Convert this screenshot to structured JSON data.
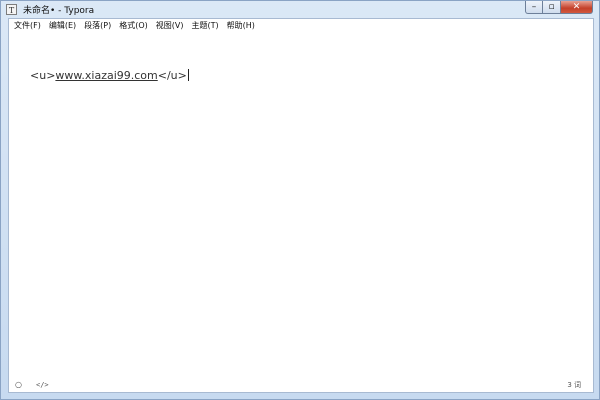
{
  "window": {
    "title": "未命名• - Typora",
    "app_icon_glyph": "T",
    "minimize_glyph": "–",
    "maximize_glyph": "▫",
    "close_glyph": "✕"
  },
  "menu": {
    "items": [
      "文件(F)",
      "编辑(E)",
      "段落(P)",
      "格式(O)",
      "视图(V)",
      "主题(T)",
      "帮助(H)"
    ]
  },
  "editor": {
    "open_tag": "<u>",
    "link_text": "www.xiazai99.com",
    "close_tag": "</u>"
  },
  "status": {
    "outline_icon_glyph": "○",
    "source_icon_glyph": "</>",
    "word_count": "3 词"
  },
  "icons": {
    "app": "typora-app-icon",
    "outline": "outline-toggle-icon",
    "source": "source-code-mode-icon"
  }
}
